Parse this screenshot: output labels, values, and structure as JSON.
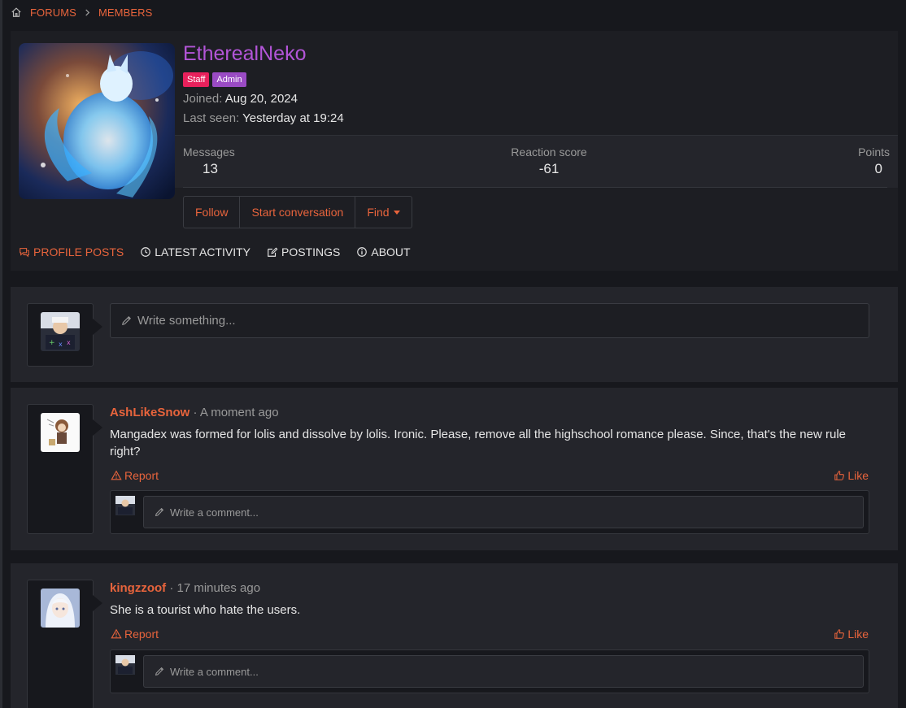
{
  "breadcrumb": {
    "items": [
      "FORUMS",
      "MEMBERS"
    ]
  },
  "profile": {
    "username": "EtherealNeko",
    "badges": [
      "Staff",
      "Admin"
    ],
    "joined_label": "Joined:",
    "joined_value": "Aug 20, 2024",
    "last_seen_label": "Last seen:",
    "last_seen_value": "Yesterday at 19:24",
    "stats": [
      {
        "label": "Messages",
        "value": "13"
      },
      {
        "label": "Reaction score",
        "value": "-61"
      },
      {
        "label": "Points",
        "value": "0"
      }
    ],
    "buttons": {
      "follow": "Follow",
      "start_conversation": "Start conversation",
      "find": "Find"
    },
    "tabs": [
      "PROFILE POSTS",
      "LATEST ACTIVITY",
      "POSTINGS",
      "ABOUT"
    ]
  },
  "composer": {
    "placeholder": "Write something..."
  },
  "posts": [
    {
      "author": "AshLikeSnow",
      "time": " · A moment ago",
      "body": "Mangadex was formed for lolis and dissolve by lolis. Ironic. Please, remove all the highschool romance please. Since, that's the new rule right?",
      "report": "Report",
      "like": "Like",
      "comment_placeholder": "Write a comment..."
    },
    {
      "author": "kingzzoof",
      "time": " · 17 minutes ago",
      "body": "She is a tourist who hate the users.",
      "report": "Report",
      "like": "Like",
      "comment_placeholder": "Write a comment..."
    }
  ],
  "colors": {
    "accent": "#e8643c",
    "username": "#b355d8",
    "staff": "#e8215c",
    "admin": "#9a4bc4"
  }
}
